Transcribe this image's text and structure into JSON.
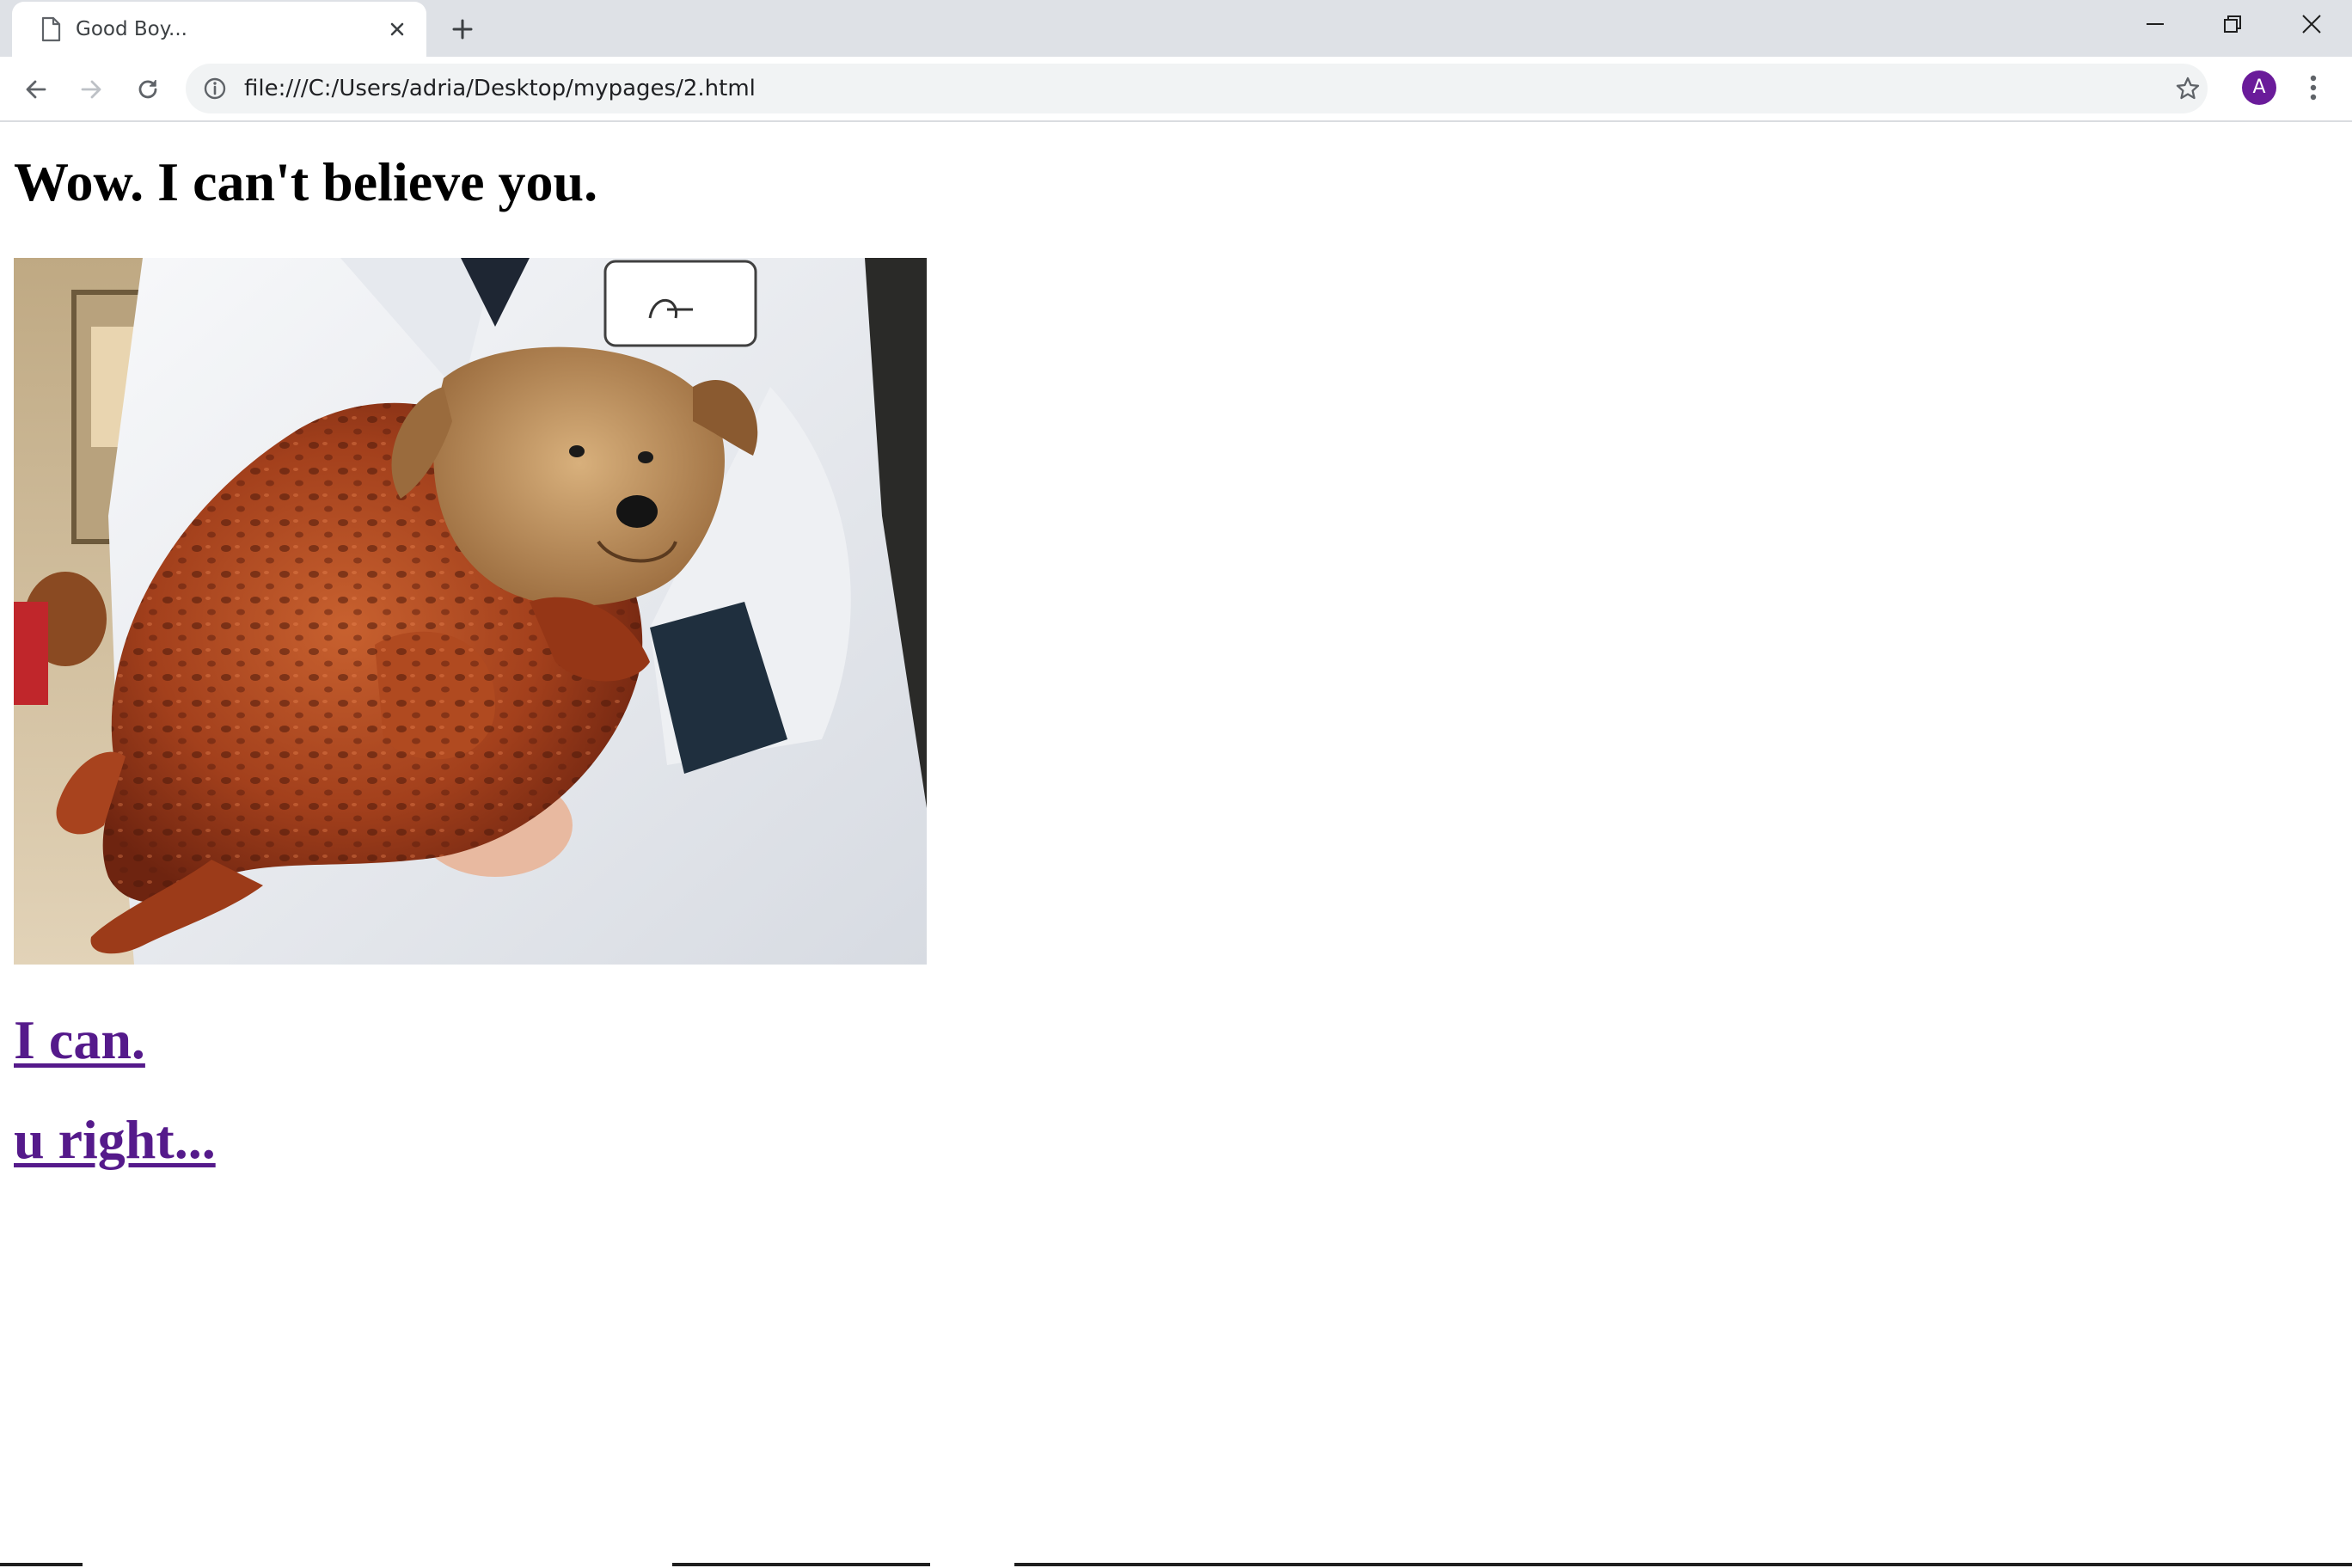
{
  "browser": {
    "tab": {
      "title": "Good Boy...",
      "close_icon": "close-icon",
      "favicon": "document-icon"
    },
    "new_tab_icon": "plus-icon",
    "window_controls": [
      "minimize-icon",
      "restore-icon",
      "close-icon"
    ],
    "toolbar": {
      "back_icon": "arrow-left-icon",
      "forward_icon": "arrow-right-icon",
      "reload_icon": "reload-icon",
      "url": "file:///C:/Users/adria/Desktop/mypages/2.html",
      "info_icon": "info-icon",
      "bookmark_icon": "star-icon",
      "profile_initial": "A",
      "menu_icon": "three-dots-vertical-icon"
    },
    "colors": {
      "tabstrip": "#dee1e6",
      "omnibox": "#f1f3f4",
      "avatar": "#6a1b9a"
    }
  },
  "page": {
    "heading": "Wow. I can't believe you.",
    "image": "photo of a small terrier dog dressed in a roast turkey costume held by a person in a white chef jacket",
    "links": [
      {
        "label": "I can."
      },
      {
        "label": "u right..."
      }
    ],
    "colors": {
      "visited_link": "#551a8b",
      "text": "#000000"
    }
  }
}
